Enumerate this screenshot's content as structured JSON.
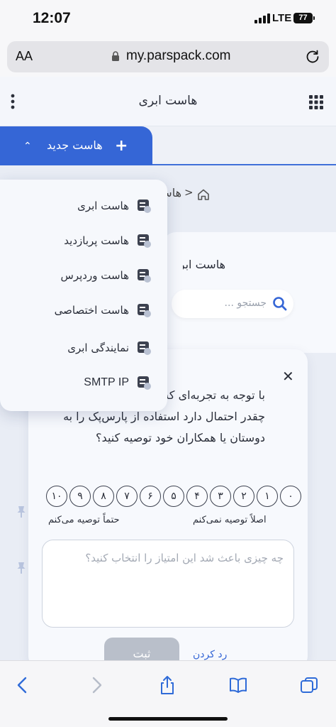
{
  "status_bar": {
    "time": "12:07",
    "network": "LTE",
    "battery": "77"
  },
  "address_bar": {
    "text_size": "AA",
    "url": "my.parspack.com"
  },
  "header": {
    "title": "هاست ابری"
  },
  "new_host_tab": {
    "label": "هاست جدید"
  },
  "breadcrumb": {
    "current": "هاست ابری"
  },
  "content": {
    "section_title": "هاست ابری",
    "search_placeholder": "جستجو ..."
  },
  "dropdown": {
    "items": [
      {
        "label": "هاست ابری",
        "icon": "cloud-host-icon"
      },
      {
        "label": "هاست پربازدید",
        "icon": "high-traffic-host-icon"
      },
      {
        "label": "هاست وردپرس",
        "icon": "wordpress-host-icon"
      },
      {
        "label": "هاست اختصاصی",
        "icon": "dedicated-host-icon"
      },
      {
        "label": "نمایندگی ابری",
        "icon": "cloud-reseller-icon"
      },
      {
        "label": "SMTP IP",
        "icon": "smtp-icon"
      }
    ]
  },
  "survey": {
    "question": "با توجه به تجربه‌ای که از پارس‌پک داشته‌اید، چقدر احتمال دارد استفاده از پارس‌پک را به دوستان یا همکاران خود توصیه کنید؟",
    "scale": [
      "۱۰",
      "۹",
      "۸",
      "۷",
      "۶",
      "۵",
      "۴",
      "۳",
      "۲",
      "۱",
      "۰"
    ],
    "label_low": "اصلاً توصیه نمی‌کنم",
    "label_high": "حتماً توصیه می‌کنم",
    "comment_placeholder": "چه چیزی باعث شد این امتیاز را انتخاب کنید؟",
    "submit_label": "ثبت",
    "reject_label": "رد کردن"
  },
  "colors": {
    "accent": "#3566d6",
    "submit_disabled": "#b9bfca"
  }
}
